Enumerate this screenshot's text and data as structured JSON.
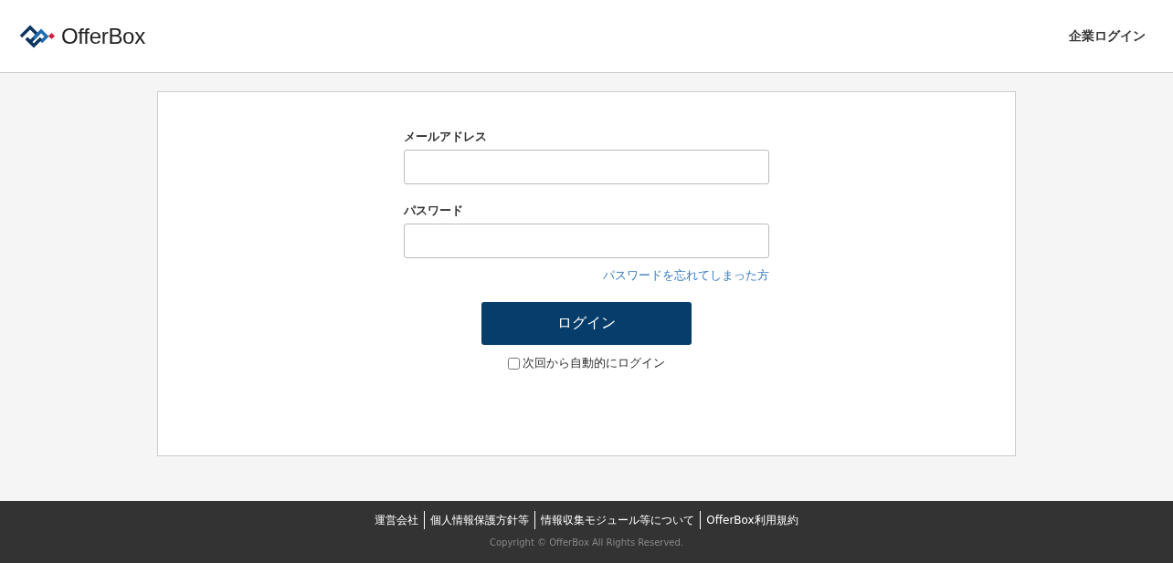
{
  "header": {
    "logo_text": "OfferBox",
    "link": "企業ログイン"
  },
  "form": {
    "fields": [
      {
        "label": "メールアドレス"
      },
      {
        "label": "パスワード"
      }
    ],
    "forgot_link": "パスワードを忘れてしまった方",
    "submit": "ログイン",
    "remember": {
      "label": "次回から自動的にログイン",
      "checked": false
    }
  },
  "footer": {
    "links": [
      "運営会社",
      "個人情報保護方針等",
      "情報収集モジュール等について",
      "OfferBox利用規約"
    ],
    "copyright": "Copyright © OfferBox All Rights Reserved."
  }
}
